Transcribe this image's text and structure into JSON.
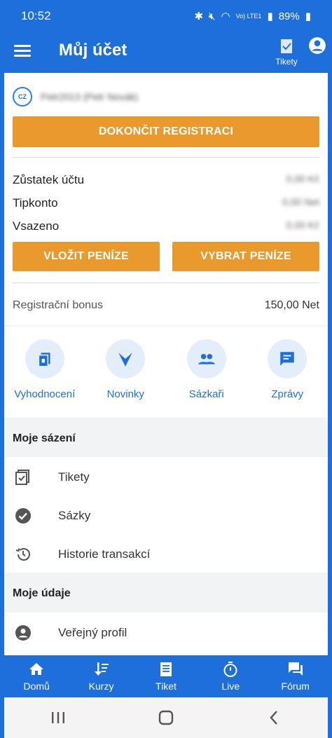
{
  "status_bar": {
    "time": "10:52",
    "battery": "89%",
    "network": "Vo) LTE1"
  },
  "app_bar": {
    "title": "Můj účet",
    "tikety_label": "Tikety"
  },
  "account": {
    "username": "Petr2013 (Petr Novák)",
    "complete_registration_button": "DOKONČIT REGISTRACI",
    "balances": [
      {
        "label": "Zůstatek účtu",
        "value": "0,00 Kč"
      },
      {
        "label": "Tipkonto",
        "value": "0,00 Net"
      },
      {
        "label": "Vsazeno",
        "value": "0,00 Kč"
      }
    ],
    "deposit_button": "VLOŽIT PENÍZE",
    "withdraw_button": "VYBRAT PENÍZE",
    "bonus": {
      "label": "Registrační bonus",
      "value": "150,00 Net"
    }
  },
  "shortcuts": [
    {
      "label": "Vyhodnocení",
      "icon": "evaluation-icon"
    },
    {
      "label": "Novinky",
      "icon": "news-icon"
    },
    {
      "label": "Sázkaři",
      "icon": "bettors-icon"
    },
    {
      "label": "Zprávy",
      "icon": "messages-icon"
    }
  ],
  "my_betting": {
    "heading": "Moje sázení",
    "items": [
      {
        "label": "Tikety",
        "icon": "tickets-icon"
      },
      {
        "label": "Sázky",
        "icon": "check-circle-icon"
      },
      {
        "label": "Historie transakcí",
        "icon": "history-icon"
      }
    ]
  },
  "my_data": {
    "heading": "Moje údaje",
    "items": [
      {
        "label": "Veřejný profil",
        "icon": "profile-icon"
      }
    ]
  },
  "bottom_nav": [
    {
      "label": "Domů",
      "icon": "home-icon"
    },
    {
      "label": "Kurzy",
      "icon": "odds-icon"
    },
    {
      "label": "Tiket",
      "icon": "ticket-icon"
    },
    {
      "label": "Live",
      "icon": "stopwatch-icon"
    },
    {
      "label": "Fórum",
      "icon": "forum-icon"
    }
  ],
  "colors": {
    "primary": "#1e6fd9",
    "accent": "#ea9a2c",
    "background": "#f2f3f5"
  }
}
